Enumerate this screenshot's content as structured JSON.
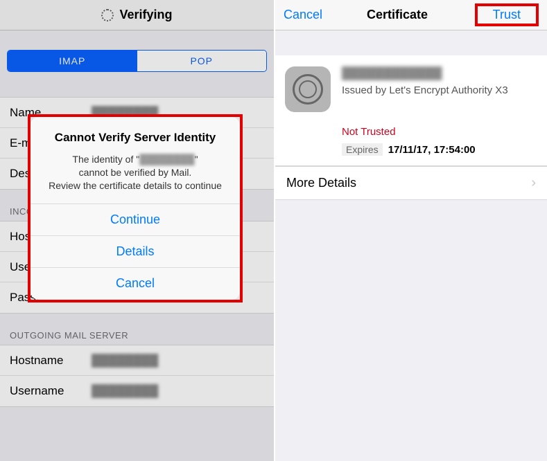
{
  "left": {
    "header_title": "Verifying",
    "segments": {
      "imap": "IMAP",
      "pop": "POP"
    },
    "form": {
      "name_label": "Name",
      "name_value": "████████",
      "email_label": "E-mail",
      "email_value": "████████",
      "desc_label": "Description",
      "desc_value": "████████"
    },
    "incoming_header": "INCOMING MAIL SERVER",
    "incoming": {
      "host_label": "Hostname",
      "host_value": "████████",
      "user_label": "Username",
      "user_value": "████████",
      "pass_label": "Password",
      "pass_value": "••••••••"
    },
    "outgoing_header": "OUTGOING MAIL SERVER",
    "outgoing": {
      "host_label": "Hostname",
      "host_value": "████████",
      "user_label": "Username",
      "user_value": "████████"
    }
  },
  "alert": {
    "title": "Cannot Verify Server Identity",
    "line1a": "The identity of \"",
    "line1b": "████████",
    "line1c": "\"",
    "line2": "cannot be verified by Mail.",
    "line3": "Review the certificate details to continue",
    "continue": "Continue",
    "details": "Details",
    "cancel": "Cancel"
  },
  "right": {
    "nav_cancel": "Cancel",
    "nav_title": "Certificate",
    "nav_trust": "Trust",
    "cert_name": "████████████",
    "issued_by_prefix": "Issued by ",
    "issued_by": "Let's Encrypt Authority X3",
    "not_trusted": "Not Trusted",
    "expires_label": "Expires",
    "expires_value": "17/11/17, 17:54:00",
    "more_details": "More Details"
  }
}
